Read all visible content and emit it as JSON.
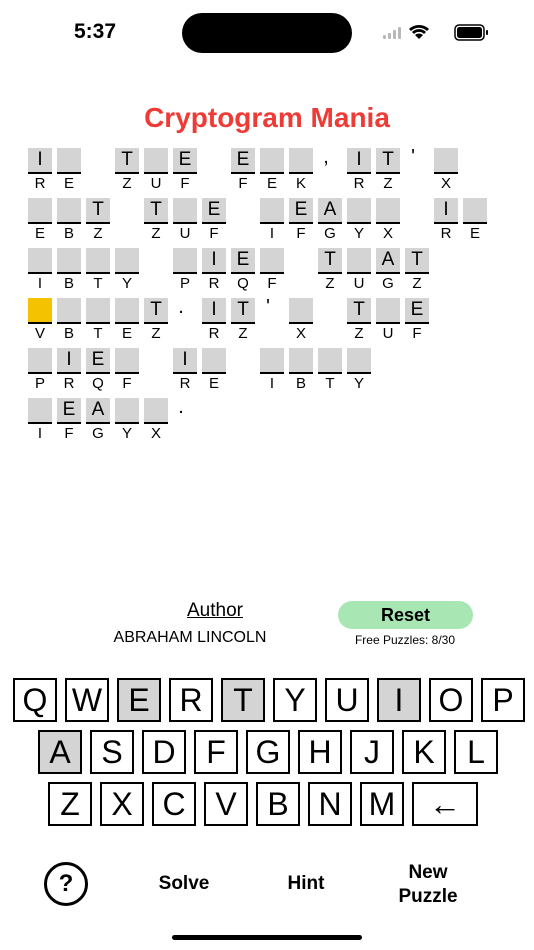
{
  "status": {
    "time": "5:37"
  },
  "title": "Cryptogram Mania",
  "puzzle": {
    "rows": [
      [
        {
          "c": "R",
          "g": "I"
        },
        {
          "c": "E",
          "g": ""
        },
        {
          "gap": 1
        },
        {
          "c": "Z",
          "g": "T"
        },
        {
          "c": "U",
          "g": ""
        },
        {
          "c": "F",
          "g": "E"
        },
        {
          "gap": 1
        },
        {
          "c": "F",
          "g": "E"
        },
        {
          "c": "E",
          "g": ""
        },
        {
          "c": "K",
          "g": ""
        },
        {
          "p": ","
        },
        {
          "c": "R",
          "g": "I"
        },
        {
          "c": "Z",
          "g": "T"
        },
        {
          "p": "'"
        },
        {
          "c": "X",
          "g": ""
        }
      ],
      [
        {
          "c": "E",
          "g": ""
        },
        {
          "c": "B",
          "g": ""
        },
        {
          "c": "Z",
          "g": "T"
        },
        {
          "gap": 1
        },
        {
          "c": "Z",
          "g": "T"
        },
        {
          "c": "U",
          "g": ""
        },
        {
          "c": "F",
          "g": "E"
        },
        {
          "gap": 1
        },
        {
          "c": "I",
          "g": ""
        },
        {
          "c": "F",
          "g": "E"
        },
        {
          "c": "G",
          "g": "A"
        },
        {
          "c": "Y",
          "g": ""
        },
        {
          "c": "X",
          "g": ""
        },
        {
          "gap": 1
        },
        {
          "c": "R",
          "g": "I"
        },
        {
          "c": "E",
          "g": ""
        }
      ],
      [
        {
          "c": "I",
          "g": ""
        },
        {
          "c": "B",
          "g": ""
        },
        {
          "c": "T",
          "g": ""
        },
        {
          "c": "Y",
          "g": ""
        },
        {
          "gap": 1
        },
        {
          "c": "P",
          "g": ""
        },
        {
          "c": "R",
          "g": "I"
        },
        {
          "c": "Q",
          "g": "E"
        },
        {
          "c": "F",
          "g": ""
        },
        {
          "gap": 1
        },
        {
          "c": "Z",
          "g": "T"
        },
        {
          "c": "U",
          "g": ""
        },
        {
          "c": "G",
          "g": "A"
        },
        {
          "c": "Z",
          "g": "T"
        }
      ],
      [
        {
          "c": "V",
          "g": "",
          "hl": true
        },
        {
          "c": "B",
          "g": ""
        },
        {
          "c": "T",
          "g": ""
        },
        {
          "c": "E",
          "g": ""
        },
        {
          "c": "Z",
          "g": "T"
        },
        {
          "p": "."
        },
        {
          "c": "R",
          "g": "I"
        },
        {
          "c": "Z",
          "g": "T"
        },
        {
          "p": "'"
        },
        {
          "c": "X",
          "g": ""
        },
        {
          "gap": 1
        },
        {
          "c": "Z",
          "g": "T"
        },
        {
          "c": "U",
          "g": ""
        },
        {
          "c": "F",
          "g": "E"
        }
      ],
      [
        {
          "c": "P",
          "g": ""
        },
        {
          "c": "R",
          "g": "I"
        },
        {
          "c": "Q",
          "g": "E"
        },
        {
          "c": "F",
          "g": ""
        },
        {
          "gap": 1
        },
        {
          "c": "R",
          "g": "I"
        },
        {
          "c": "E",
          "g": ""
        },
        {
          "gap": 1
        },
        {
          "c": "I",
          "g": ""
        },
        {
          "c": "B",
          "g": ""
        },
        {
          "c": "T",
          "g": ""
        },
        {
          "c": "Y",
          "g": ""
        }
      ],
      [
        {
          "c": "I",
          "g": ""
        },
        {
          "c": "F",
          "g": "E"
        },
        {
          "c": "G",
          "g": "A"
        },
        {
          "c": "Y",
          "g": ""
        },
        {
          "c": "X",
          "g": ""
        },
        {
          "p": "."
        }
      ]
    ]
  },
  "author": {
    "heading": "Author",
    "name": "ABRAHAM LINCOLN"
  },
  "reset_label": "Reset",
  "free_puzzles": "Free Puzzles: 8/30",
  "keyboard": {
    "rows": [
      [
        {
          "k": "Q"
        },
        {
          "k": "W"
        },
        {
          "k": "E",
          "used": true
        },
        {
          "k": "R"
        },
        {
          "k": "T",
          "used": true
        },
        {
          "k": "Y"
        },
        {
          "k": "U"
        },
        {
          "k": "I",
          "used": true
        },
        {
          "k": "O"
        },
        {
          "k": "P"
        }
      ],
      [
        {
          "k": "A",
          "used": true
        },
        {
          "k": "S"
        },
        {
          "k": "D"
        },
        {
          "k": "F"
        },
        {
          "k": "G"
        },
        {
          "k": "H"
        },
        {
          "k": "J"
        },
        {
          "k": "K"
        },
        {
          "k": "L"
        }
      ],
      [
        {
          "k": "Z"
        },
        {
          "k": "X"
        },
        {
          "k": "C"
        },
        {
          "k": "V"
        },
        {
          "k": "B"
        },
        {
          "k": "N"
        },
        {
          "k": "M"
        },
        {
          "k": "←",
          "wide": true
        }
      ]
    ]
  },
  "bottom": {
    "help": "?",
    "solve": "Solve",
    "hint": "Hint",
    "new_puzzle_line1": "New",
    "new_puzzle_line2": "Puzzle"
  },
  "colors": {
    "title": "#ef3b35",
    "highlight": "#f5c200",
    "reset": "#a8e6b4",
    "cell": "#d4d4d4"
  }
}
